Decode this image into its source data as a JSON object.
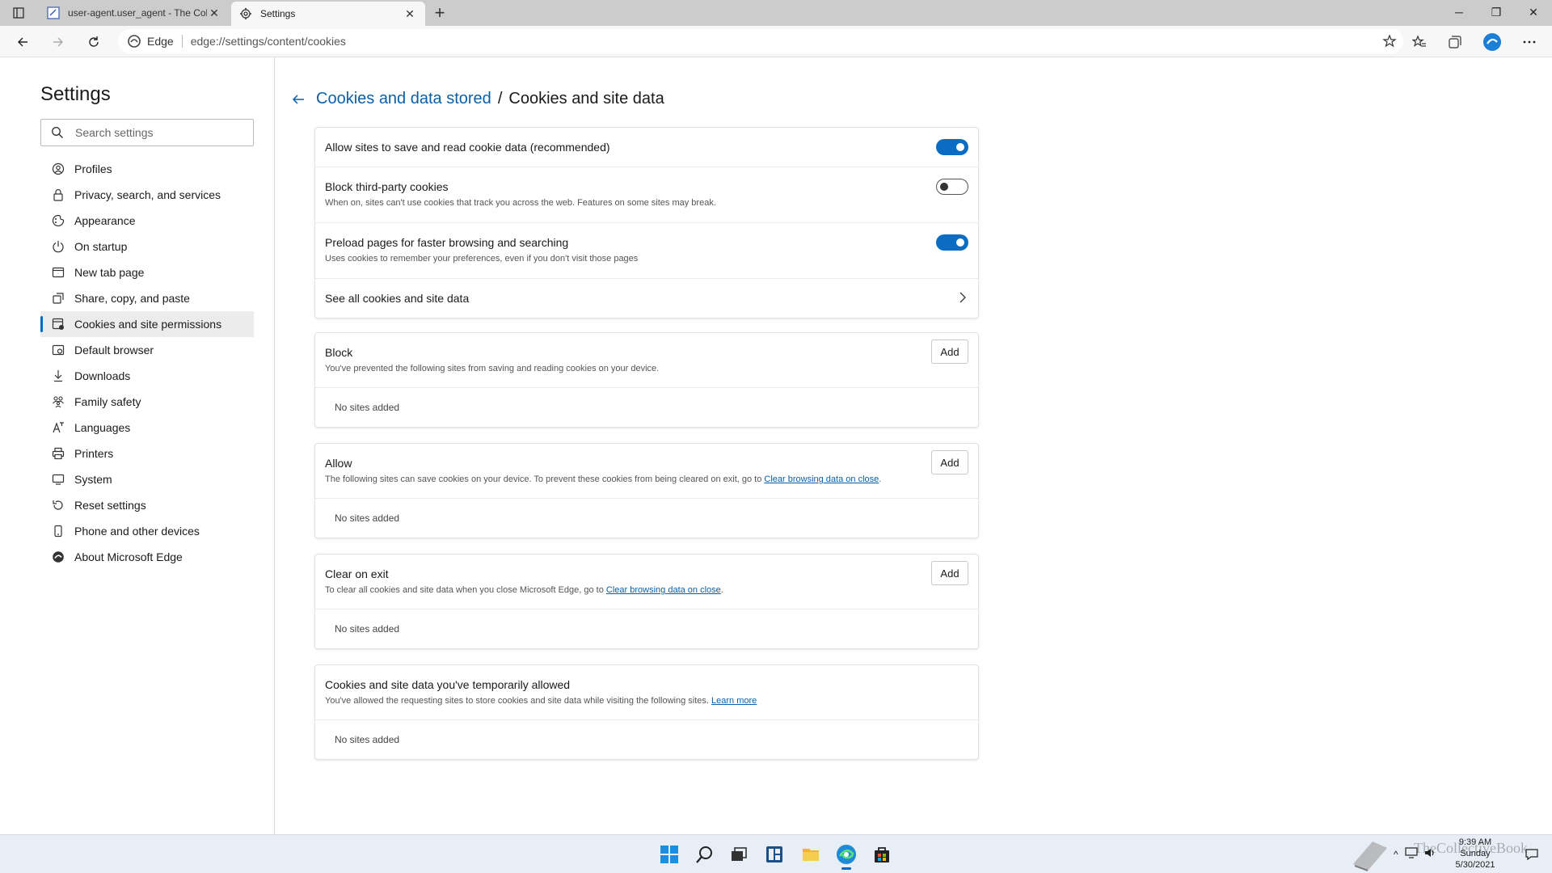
{
  "tabs": [
    {
      "title": "user-agent.user_agent - The Coll",
      "active": false
    },
    {
      "title": "Settings",
      "active": true
    }
  ],
  "toolbar": {
    "site_label": "Edge",
    "url": "edge://settings/content/cookies"
  },
  "sidebar": {
    "title": "Settings",
    "search_placeholder": "Search settings",
    "items": [
      {
        "label": "Profiles",
        "icon": "profile-icon"
      },
      {
        "label": "Privacy, search, and services",
        "icon": "lock-icon"
      },
      {
        "label": "Appearance",
        "icon": "appearance-icon"
      },
      {
        "label": "On startup",
        "icon": "power-icon"
      },
      {
        "label": "New tab page",
        "icon": "new-tab-icon"
      },
      {
        "label": "Share, copy, and paste",
        "icon": "share-icon"
      },
      {
        "label": "Cookies and site permissions",
        "icon": "cookies-icon",
        "selected": true
      },
      {
        "label": "Default browser",
        "icon": "browser-icon"
      },
      {
        "label": "Downloads",
        "icon": "download-icon"
      },
      {
        "label": "Family safety",
        "icon": "family-icon"
      },
      {
        "label": "Languages",
        "icon": "languages-icon"
      },
      {
        "label": "Printers",
        "icon": "printer-icon"
      },
      {
        "label": "System",
        "icon": "system-icon"
      },
      {
        "label": "Reset settings",
        "icon": "reset-icon"
      },
      {
        "label": "Phone and other devices",
        "icon": "phone-icon"
      },
      {
        "label": "About Microsoft Edge",
        "icon": "edge-icon"
      }
    ]
  },
  "breadcrumb": {
    "parent": "Cookies and data stored",
    "separator": "/",
    "current": "Cookies and site data"
  },
  "settings_card": {
    "allow_cookies": {
      "title": "Allow sites to save and read cookie data (recommended)",
      "enabled": true
    },
    "block_third_party": {
      "title": "Block third-party cookies",
      "desc": "When on, sites can't use cookies that track you across the web. Features on some sites may break.",
      "enabled": false
    },
    "preload": {
      "title": "Preload pages for faster browsing and searching",
      "desc": "Uses cookies to remember your preferences, even if you don't visit those pages",
      "enabled": true
    },
    "see_all": {
      "title": "See all cookies and site data"
    }
  },
  "lists": {
    "block": {
      "title": "Block",
      "desc": "You've prevented the following sites from saving and reading cookies on your device.",
      "add_label": "Add",
      "empty": "No sites added"
    },
    "allow": {
      "title": "Allow",
      "desc_prefix": "The following sites can save cookies on your device. To prevent these cookies from being cleared on exit, go to ",
      "desc_link": "Clear browsing data on close",
      "desc_suffix": ".",
      "add_label": "Add",
      "empty": "No sites added"
    },
    "clear_on_exit": {
      "title": "Clear on exit",
      "desc_prefix": "To clear all cookies and site data when you close Microsoft Edge, go to ",
      "desc_link": "Clear browsing data on close",
      "desc_suffix": ".",
      "add_label": "Add",
      "empty": "No sites added"
    },
    "temporary": {
      "title": "Cookies and site data you've temporarily allowed",
      "desc_prefix": "You've allowed the requesting sites to store cookies and site data while visiting the following sites. ",
      "desc_link": "Learn more",
      "empty": "No sites added"
    }
  },
  "taskbar": {
    "time": "9:39 AM",
    "day": "Sunday",
    "date": "5/30/2021",
    "watermark": "TheCollectiveBook"
  },
  "colors": {
    "accent": "#0b6cc4",
    "link": "#0b5fa8",
    "taskbar": "#e8eef6"
  }
}
